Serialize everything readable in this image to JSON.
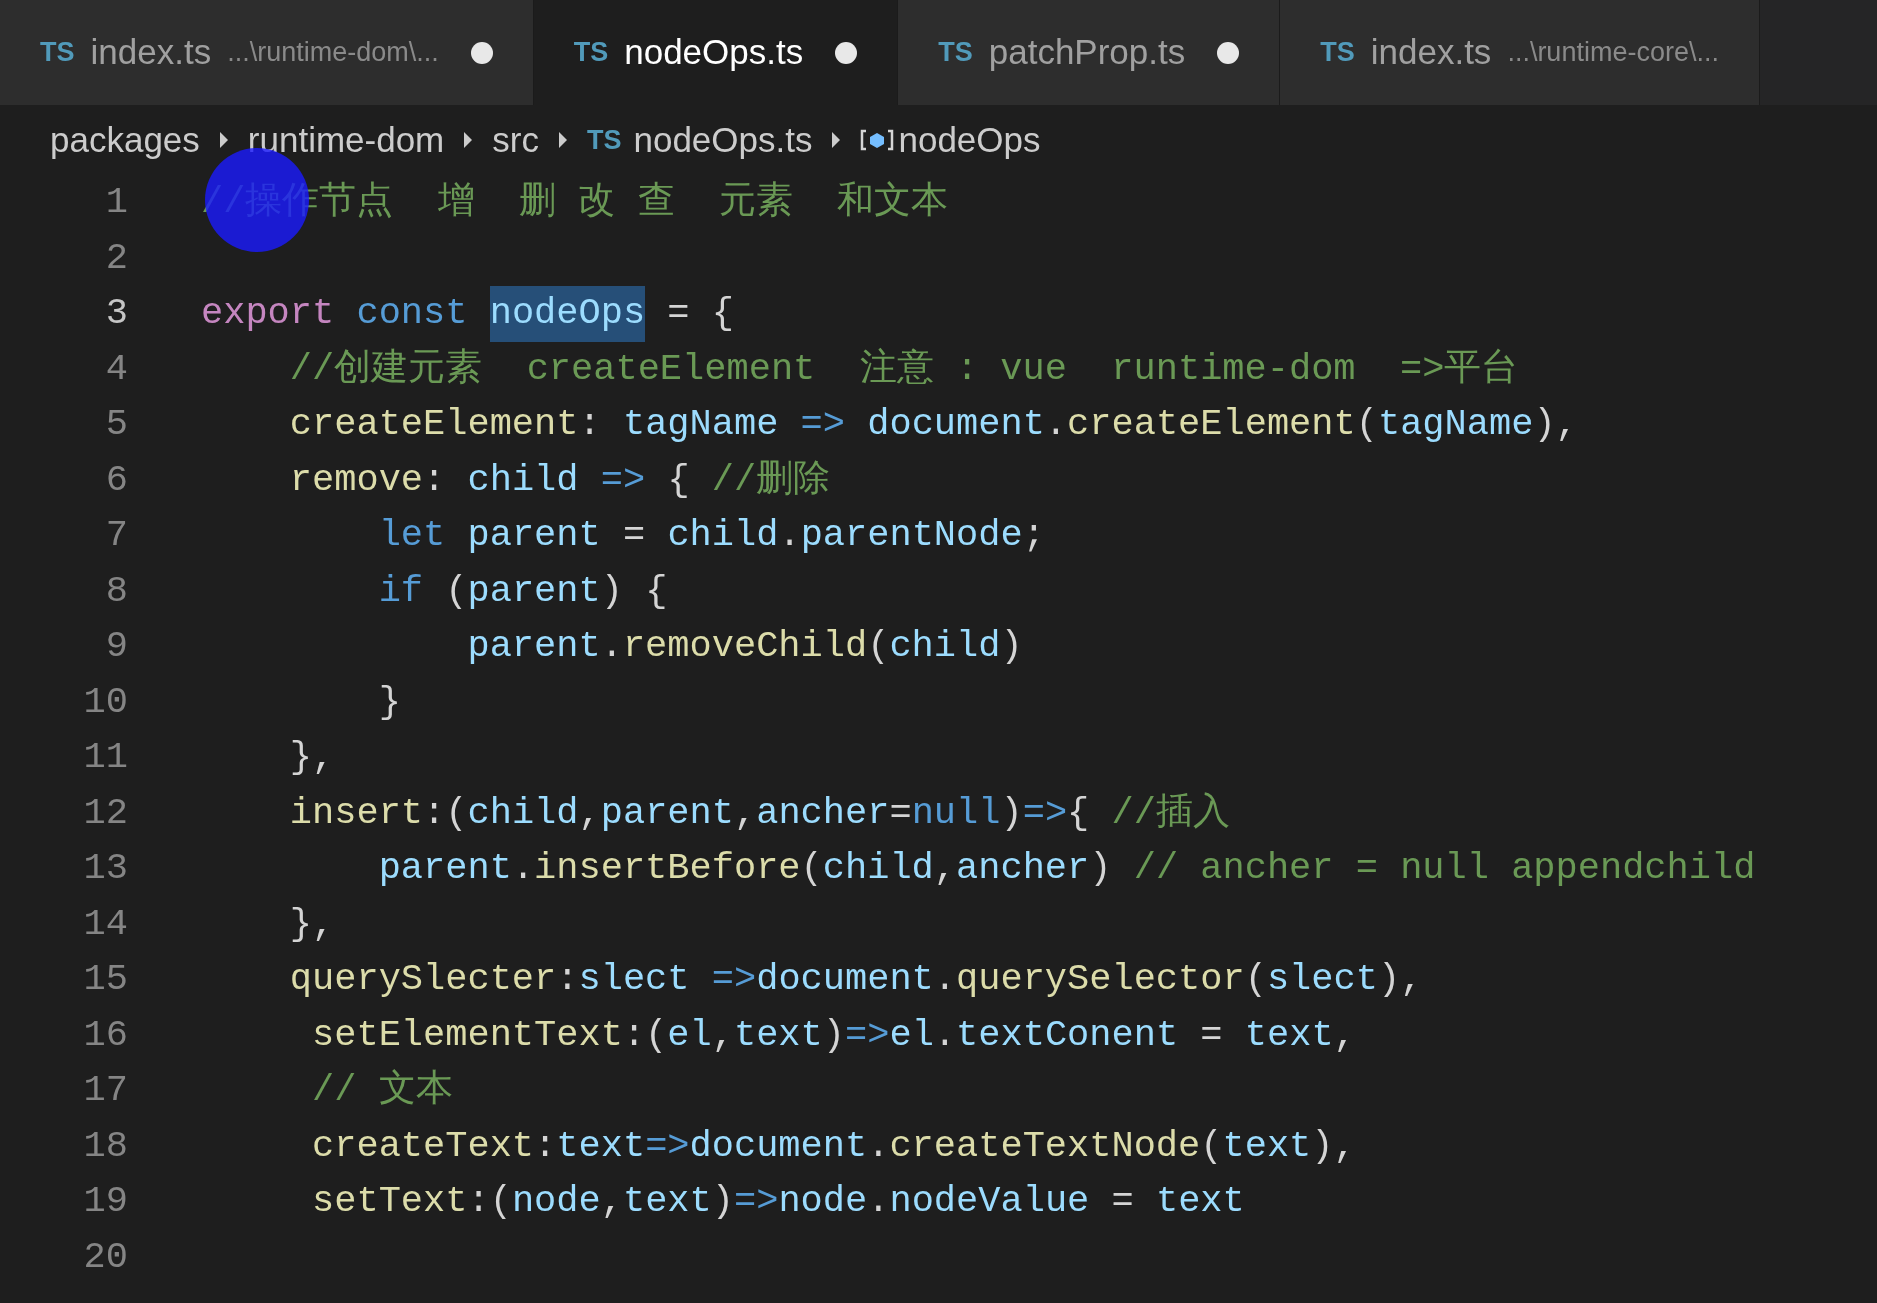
{
  "tabs": [
    {
      "icon_text": "TS",
      "label": "index.ts",
      "description": "...\\runtime-dom\\...",
      "dirty": true,
      "selected": false
    },
    {
      "icon_text": "TS",
      "label": "nodeOps.ts",
      "dirty": true,
      "selected": true
    },
    {
      "icon_text": "TS",
      "label": "patchProp.ts",
      "dirty": true,
      "selected": false
    },
    {
      "icon_text": "TS",
      "label": "index.ts",
      "description": "...\\runtime-core\\...",
      "dirty": false,
      "selected": false
    }
  ],
  "breadcrumb": [
    {
      "kind": "folder",
      "label": "packages"
    },
    {
      "kind": "folder",
      "label": "runtime-dom"
    },
    {
      "kind": "folder",
      "label": "src"
    },
    {
      "kind": "file",
      "icon_text": "TS",
      "label": "nodeOps.ts"
    },
    {
      "kind": "symbol",
      "label": "nodeOps"
    }
  ],
  "cursor_highlight": true,
  "lines": [
    {
      "number": "1",
      "active": false,
      "tokens": [
        {
          "kind": "comment",
          "text": "//操作节点  增  删 改 查  元素  和文本"
        }
      ]
    },
    {
      "number": "2",
      "active": false
    },
    {
      "number": "3",
      "active": true,
      "tokens": [
        {
          "kind": "export",
          "text": "export"
        },
        {
          "kind": "keyword",
          "text": " const"
        },
        {
          "kind": "selection",
          "text": " nodeOps"
        },
        {
          "kind": "plain",
          "text": " = {"
        }
      ]
    },
    {
      "number": "4",
      "active": false,
      "tokens": [
        {
          "kind": "comment",
          "text": "    //创建元素  createElement  注意 : vue  runtime-dom  =>平台"
        }
      ]
    },
    {
      "number": "5",
      "active": false,
      "tokens": [
        {
          "kind": "property",
          "text": "    createElement"
        },
        {
          "kind": "plain",
          "text": ":"
        },
        {
          "kind": "variable",
          "text": " tagName"
        },
        {
          "kind": "keyword",
          "text": " =>"
        },
        {
          "kind": "variable",
          "text": " document"
        },
        {
          "kind": "plain",
          "text": "."
        },
        {
          "kind": "function",
          "text": "createElement"
        },
        {
          "kind": "plain",
          "text": "("
        },
        {
          "kind": "variable",
          "text": "tagName"
        },
        {
          "kind": "plain",
          "text": "),"
        }
      ]
    },
    {
      "number": "6",
      "active": false,
      "tokens": [
        {
          "kind": "property",
          "text": "    remove"
        },
        {
          "kind": "plain",
          "text": ":"
        },
        {
          "kind": "variable",
          "text": " child"
        },
        {
          "kind": "keyword",
          "text": " =>"
        },
        {
          "kind": "plain",
          "text": " {"
        },
        {
          "kind": "comment",
          "text": " //删除"
        }
      ]
    },
    {
      "number": "7",
      "active": false,
      "tokens": [
        {
          "kind": "keyword",
          "text": "        let"
        },
        {
          "kind": "variable",
          "text": " parent"
        },
        {
          "kind": "plain",
          "text": " ="
        },
        {
          "kind": "variable",
          "text": " child"
        },
        {
          "kind": "plain",
          "text": "."
        },
        {
          "kind": "variable",
          "text": "parentNode"
        },
        {
          "kind": "plain",
          "text": ";"
        }
      ]
    },
    {
      "number": "8",
      "active": false,
      "tokens": [
        {
          "kind": "keyword",
          "text": "        if"
        },
        {
          "kind": "plain",
          "text": " ("
        },
        {
          "kind": "variable",
          "text": "parent"
        },
        {
          "kind": "plain",
          "text": ") {"
        }
      ]
    },
    {
      "number": "9",
      "active": false,
      "tokens": [
        {
          "kind": "variable",
          "text": "            parent"
        },
        {
          "kind": "plain",
          "text": "."
        },
        {
          "kind": "function",
          "text": "removeChild"
        },
        {
          "kind": "plain",
          "text": "("
        },
        {
          "kind": "variable",
          "text": "child"
        },
        {
          "kind": "plain",
          "text": ")"
        }
      ]
    },
    {
      "number": "10",
      "active": false,
      "tokens": [
        {
          "kind": "plain",
          "text": "        }"
        }
      ]
    },
    {
      "number": "11",
      "active": false,
      "tokens": [
        {
          "kind": "plain",
          "text": "    },"
        }
      ]
    },
    {
      "number": "12",
      "active": false,
      "tokens": [
        {
          "kind": "property",
          "text": "    insert"
        },
        {
          "kind": "plain",
          "text": ":("
        },
        {
          "kind": "variable",
          "text": "child"
        },
        {
          "kind": "plain",
          "text": ","
        },
        {
          "kind": "variable",
          "text": "parent"
        },
        {
          "kind": "plain",
          "text": ","
        },
        {
          "kind": "variable",
          "text": "ancher"
        },
        {
          "kind": "plain",
          "text": "="
        },
        {
          "kind": "keyword",
          "text": "null"
        },
        {
          "kind": "plain",
          "text": ")"
        },
        {
          "kind": "keyword",
          "text": "=>"
        },
        {
          "kind": "plain",
          "text": "{"
        },
        {
          "kind": "comment",
          "text": " //插入"
        }
      ]
    },
    {
      "number": "13",
      "active": false,
      "tokens": [
        {
          "kind": "variable",
          "text": "        parent"
        },
        {
          "kind": "plain",
          "text": "."
        },
        {
          "kind": "function",
          "text": "insertBefore"
        },
        {
          "kind": "plain",
          "text": "("
        },
        {
          "kind": "variable",
          "text": "child"
        },
        {
          "kind": "plain",
          "text": ","
        },
        {
          "kind": "variable",
          "text": "ancher"
        },
        {
          "kind": "plain",
          "text": ")"
        },
        {
          "kind": "comment",
          "text": " // ancher = null appendchild"
        }
      ]
    },
    {
      "number": "14",
      "active": false,
      "tokens": [
        {
          "kind": "plain",
          "text": "    },"
        }
      ]
    },
    {
      "number": "15",
      "active": false,
      "tokens": [
        {
          "kind": "property",
          "text": "    querySlecter"
        },
        {
          "kind": "plain",
          "text": ":"
        },
        {
          "kind": "variable",
          "text": "slect"
        },
        {
          "kind": "keyword",
          "text": " =>"
        },
        {
          "kind": "variable",
          "text": "document"
        },
        {
          "kind": "plain",
          "text": "."
        },
        {
          "kind": "function",
          "text": "querySelector"
        },
        {
          "kind": "plain",
          "text": "("
        },
        {
          "kind": "variable",
          "text": "slect"
        },
        {
          "kind": "plain",
          "text": "),"
        }
      ]
    },
    {
      "number": "16",
      "active": false,
      "tokens": [
        {
          "kind": "property",
          "text": "     setElementText"
        },
        {
          "kind": "plain",
          "text": ":("
        },
        {
          "kind": "variable",
          "text": "el"
        },
        {
          "kind": "plain",
          "text": ","
        },
        {
          "kind": "variable",
          "text": "text"
        },
        {
          "kind": "plain",
          "text": ")"
        },
        {
          "kind": "keyword",
          "text": "=>"
        },
        {
          "kind": "variable",
          "text": "el"
        },
        {
          "kind": "plain",
          "text": "."
        },
        {
          "kind": "variable",
          "text": "textConent"
        },
        {
          "kind": "plain",
          "text": " ="
        },
        {
          "kind": "variable",
          "text": " text"
        },
        {
          "kind": "plain",
          "text": ","
        }
      ]
    },
    {
      "number": "17",
      "active": false,
      "tokens": [
        {
          "kind": "comment",
          "text": "     // 文本"
        }
      ]
    },
    {
      "number": "18",
      "active": false,
      "tokens": [
        {
          "kind": "property",
          "text": "     createText"
        },
        {
          "kind": "plain",
          "text": ":"
        },
        {
          "kind": "variable",
          "text": "text"
        },
        {
          "kind": "keyword",
          "text": "=>"
        },
        {
          "kind": "variable",
          "text": "document"
        },
        {
          "kind": "plain",
          "text": "."
        },
        {
          "kind": "function",
          "text": "createTextNode"
        },
        {
          "kind": "plain",
          "text": "("
        },
        {
          "kind": "variable",
          "text": "text"
        },
        {
          "kind": "plain",
          "text": "),"
        }
      ]
    },
    {
      "number": "19",
      "active": false,
      "tokens": [
        {
          "kind": "property",
          "text": "     setText"
        },
        {
          "kind": "plain",
          "text": ":("
        },
        {
          "kind": "variable",
          "text": "node"
        },
        {
          "kind": "plain",
          "text": ","
        },
        {
          "kind": "variable",
          "text": "text"
        },
        {
          "kind": "plain",
          "text": ")"
        },
        {
          "kind": "keyword",
          "text": "=>"
        },
        {
          "kind": "variable",
          "text": "node"
        },
        {
          "kind": "plain",
          "text": "."
        },
        {
          "kind": "variable",
          "text": "nodeValue"
        },
        {
          "kind": "plain",
          "text": " ="
        },
        {
          "kind": "variable",
          "text": " text"
        }
      ]
    },
    {
      "number": "20",
      "active": false
    }
  ]
}
